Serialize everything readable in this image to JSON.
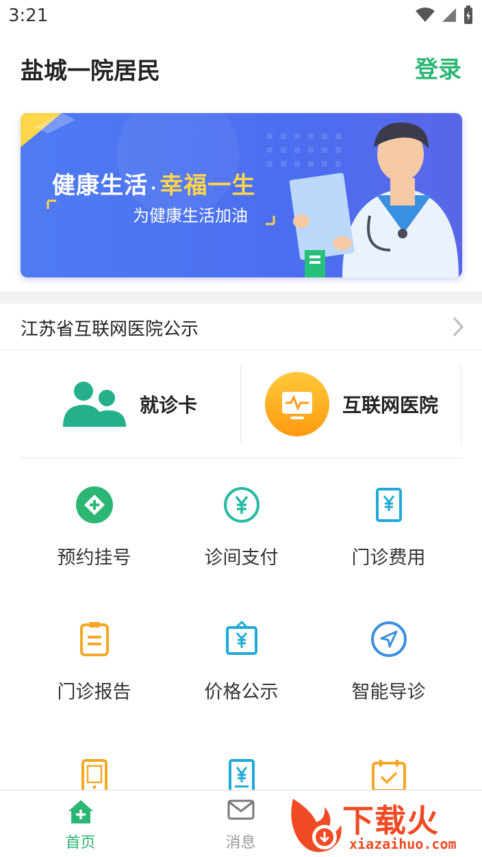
{
  "status_bar": {
    "time": "3:21"
  },
  "header": {
    "title": "盐城一院居民",
    "login_label": "登录"
  },
  "banner": {
    "title_part1": "健康生活",
    "title_dot": "·",
    "title_part2": "幸福一生",
    "subtitle": "为健康生活加油"
  },
  "notice": {
    "label": "江苏省互联网医院公示"
  },
  "features": [
    {
      "label": "就诊卡",
      "icon": "people-icon"
    },
    {
      "label": "互联网医院",
      "icon": "monitor-icon"
    }
  ],
  "grid": [
    {
      "label": "预约挂号",
      "icon": "plus-diamond-icon",
      "color": "#2bb673"
    },
    {
      "label": "诊间支付",
      "icon": "yen-circle-icon",
      "color": "#26b9a4"
    },
    {
      "label": "门诊费用",
      "icon": "yen-doc-icon",
      "color": "#1fa9d8"
    },
    {
      "label": "门诊报告",
      "icon": "clipboard-icon",
      "color": "#f5a623"
    },
    {
      "label": "价格公示",
      "icon": "price-board-icon",
      "color": "#1fa9d8"
    },
    {
      "label": "智能导诊",
      "icon": "compass-icon",
      "color": "#3a8fe0"
    },
    {
      "label": "",
      "icon": "tablet-icon",
      "color": "#f5a623"
    },
    {
      "label": "",
      "icon": "yen-doc-icon",
      "color": "#1fa9d8"
    },
    {
      "label": "",
      "icon": "calendar-check-icon",
      "color": "#f5a623"
    }
  ],
  "bottom_nav": [
    {
      "label": "首页",
      "icon": "home-icon"
    },
    {
      "label": "消息",
      "icon": "mail-icon"
    }
  ],
  "watermark": {
    "cn": "下载火",
    "en": "xiazaihuo.com"
  },
  "colors": {
    "accent": "#2bb673",
    "banner": "#4f7bf2",
    "orange": "#f5a623"
  }
}
